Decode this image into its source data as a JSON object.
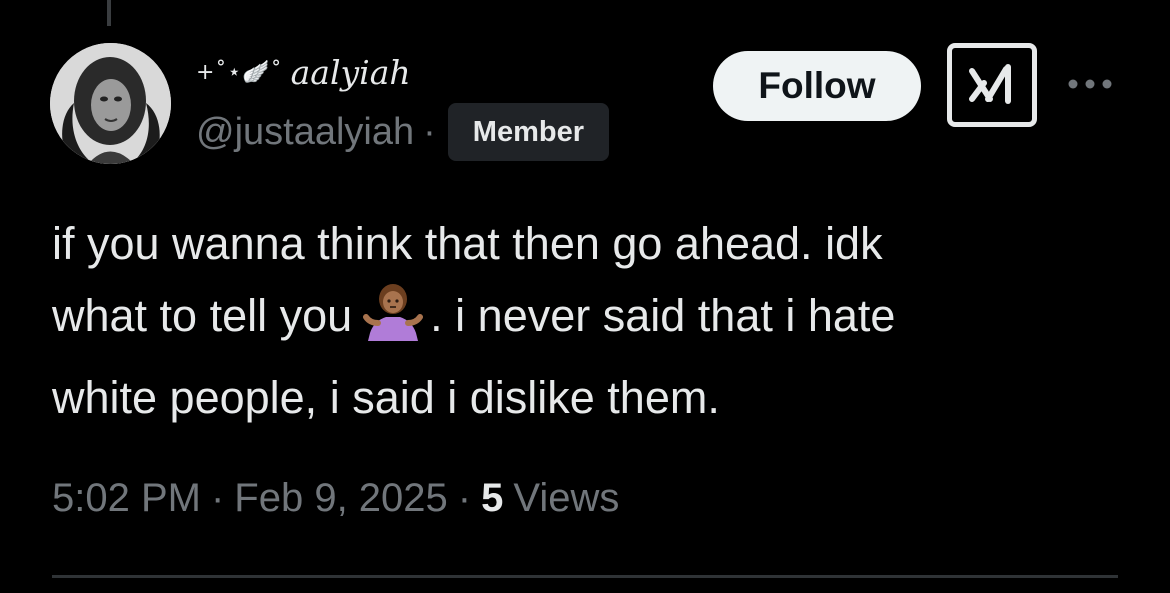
{
  "author": {
    "display_name_decoration": "+˚⋆🪽˚",
    "display_name": "aalyiah",
    "handle": "@justaalyiah",
    "separator": "·",
    "badge": "Member",
    "avatar_icon": "profile-photo"
  },
  "actions": {
    "follow_label": "Follow",
    "grok_icon": "grok-icon",
    "more_icon": "more-horizontal-icon"
  },
  "tweet": {
    "line1": "if you wanna think that then go ahead. idk",
    "line2_before_emoji": "what to tell you",
    "emoji_icon": "person-shrugging-emoji",
    "line2_after_emoji": ". i never said that i hate",
    "line3": "white people, i said i dislike them."
  },
  "meta": {
    "time": "5:02 PM",
    "date": "Feb 9, 2025",
    "separator": "·",
    "view_count": "5",
    "views_label": "Views"
  },
  "colors": {
    "background": "#000000",
    "text_primary": "#e7e9ea",
    "text_secondary": "#71767b",
    "badge_bg": "#202327",
    "follow_bg": "#eff3f4",
    "divider": "#2f3336"
  }
}
